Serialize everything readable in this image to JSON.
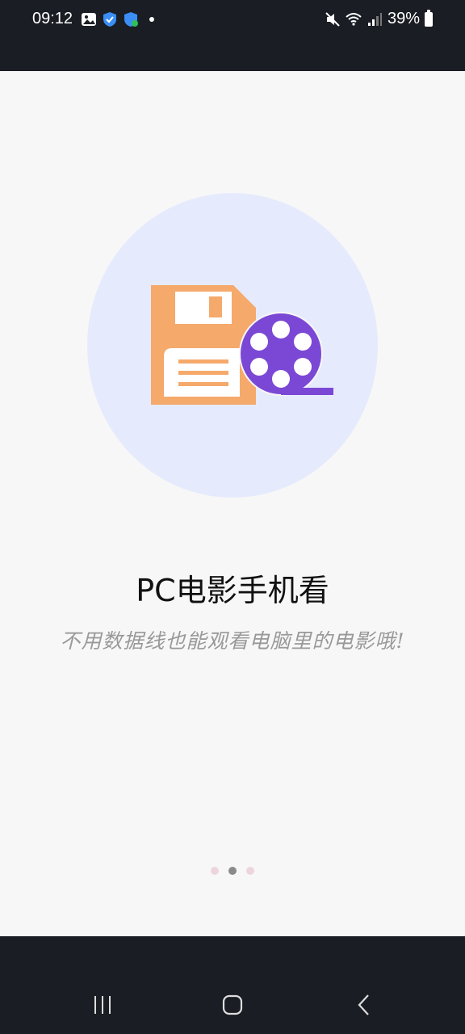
{
  "status_bar": {
    "time": "09:12",
    "battery": "39%",
    "icons_left": [
      "image-icon",
      "shield-icon",
      "shield-check-icon",
      "dot-icon"
    ],
    "icons_right": [
      "mute-icon",
      "wifi-icon",
      "signal-icon",
      "battery-icon"
    ]
  },
  "onboarding": {
    "title": "PC电影手机看",
    "subtitle": "不用数据线也能观看电脑里的电影哦!",
    "page_index": 2,
    "page_count": 3,
    "colors": {
      "circle_bg": "#e6eafd",
      "disk": "#f5a96b",
      "film": "#7b48d6"
    }
  },
  "nav_bar": {
    "buttons": [
      "recent-apps-button",
      "home-button",
      "back-button"
    ]
  }
}
